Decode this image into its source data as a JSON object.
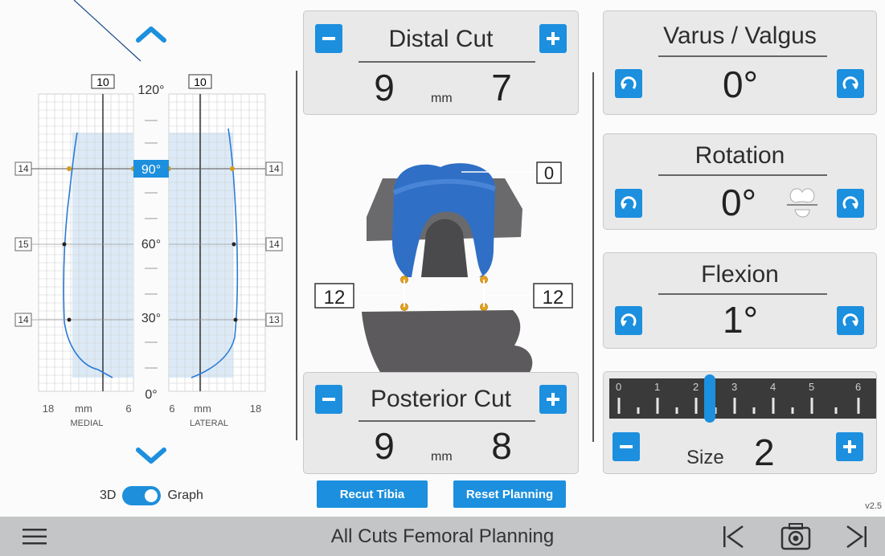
{
  "graph": {
    "angle_labels": [
      "120°",
      "90°",
      "60°",
      "30°",
      "0°"
    ],
    "top_markers": {
      "left": "10",
      "right": "10"
    },
    "left_markers": [
      "14",
      "15",
      "14"
    ],
    "right_markers": [
      "14",
      "14",
      "13"
    ],
    "axis_medial": {
      "left": "18",
      "unit": "mm",
      "right": "6",
      "name": "MEDIAL"
    },
    "axis_lateral": {
      "left": "6",
      "unit": "mm",
      "right": "18",
      "name": "LATERAL"
    },
    "accent": "#1c8fde"
  },
  "toggle": {
    "left_label": "3D",
    "right_label": "Graph",
    "state": "Graph"
  },
  "distal_cut": {
    "title": "Distal Cut",
    "left_value": "9",
    "unit": "mm",
    "right_value": "7"
  },
  "posterior_cut": {
    "title": "Posterior Cut",
    "left_value": "9",
    "unit": "mm",
    "right_value": "8"
  },
  "model": {
    "top_label": "0",
    "left_label": "12",
    "right_label": "12"
  },
  "varus_valgus": {
    "title": "Varus / Valgus",
    "value": "0°"
  },
  "rotation": {
    "title": "Rotation",
    "value": "0°"
  },
  "flexion": {
    "title": "Flexion",
    "value": "1°"
  },
  "size": {
    "label": "Size",
    "value": "2",
    "scale": [
      "0",
      "1",
      "2",
      "3",
      "4",
      "5",
      "6"
    ]
  },
  "buttons": {
    "recut_tibia": "Recut Tibia",
    "reset_planning": "Reset Planning"
  },
  "version": "v2.5",
  "footer": {
    "title": "All Cuts Femoral Planning"
  }
}
